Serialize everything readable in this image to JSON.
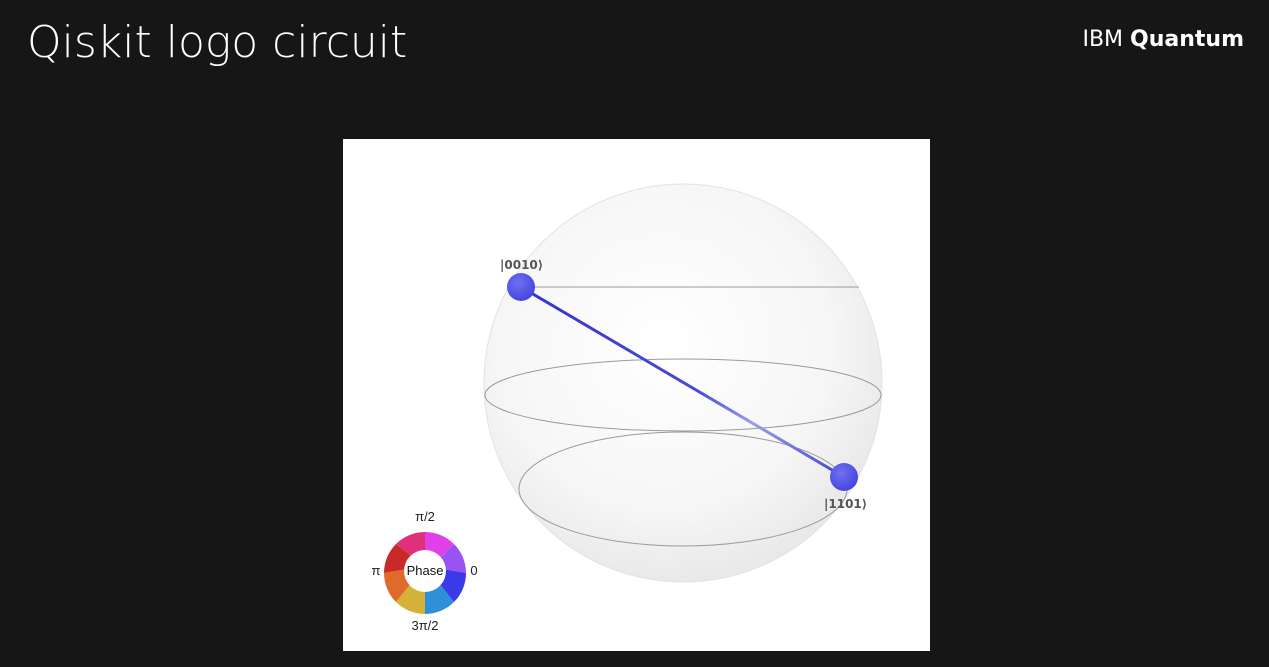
{
  "slide": {
    "title": "Qiskit logo circuit",
    "background_color": "#161616",
    "text_color": "#ffffff"
  },
  "brand": {
    "company": "IBM",
    "product": "Quantum"
  },
  "figure": {
    "type": "qsphere",
    "states": [
      {
        "label": "|0010⟩",
        "phase_color": "#5a5ae8"
      },
      {
        "label": "|1101⟩",
        "phase_color": "#5a5ae8"
      }
    ],
    "link_color": "#3c3cd8",
    "phase_legend": {
      "center_label": "Phase",
      "top_label": "π/2",
      "left_label": "π",
      "right_label": "0",
      "bottom_label": "3π/2"
    }
  }
}
